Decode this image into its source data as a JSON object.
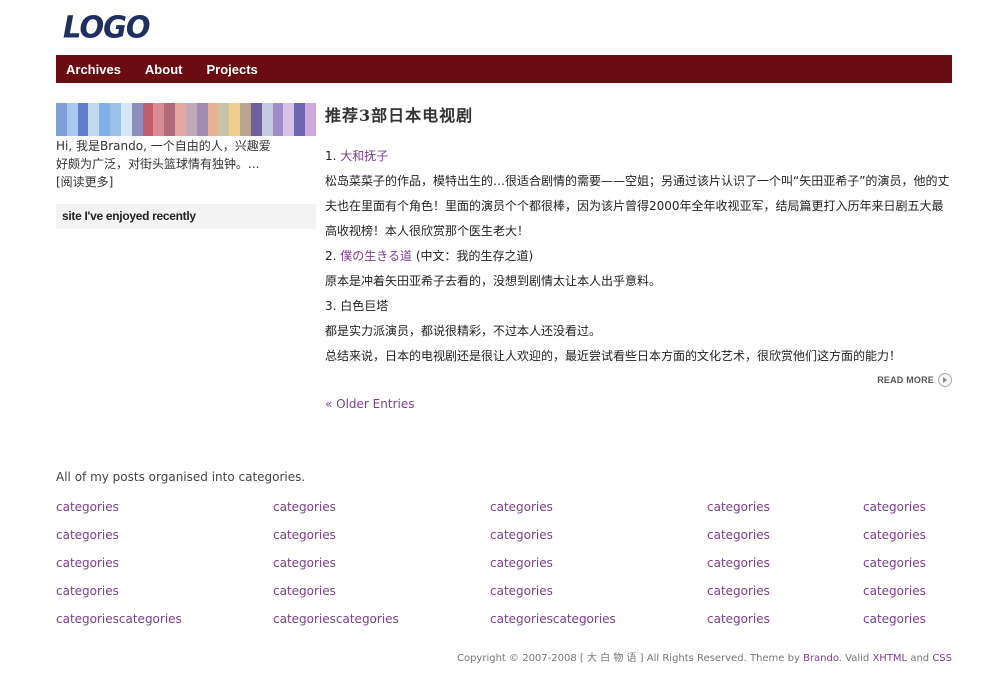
{
  "logo": "LOGO",
  "nav": {
    "items": [
      {
        "label": "Archives"
      },
      {
        "label": "About"
      },
      {
        "label": "Projects"
      }
    ]
  },
  "sidebar": {
    "banner_colors": [
      "#7f9fd6",
      "#a8c8ef",
      "#5f7fc8",
      "#c0d9f0",
      "#7fb0e8",
      "#9ac1ea",
      "#d7e6f7",
      "#8e8fb8",
      "#c25c6f",
      "#d98c96",
      "#b26a7a",
      "#e6a7a1",
      "#c3a9b7",
      "#9e8bb6",
      "#e8b08c",
      "#c9c4a8",
      "#f0cf8c",
      "#b7a78e",
      "#6f5fa0",
      "#c4c8e2",
      "#a08cc8",
      "#d6c3e6",
      "#7066b0",
      "#cba9d8"
    ],
    "intro": "Hi, 我是Brando, 一个自由的人，兴趣爱好颇为广泛，对街头篮球情有独钟。...[阅读更多]",
    "box_title": "site I've enjoyed recently"
  },
  "post": {
    "title": "推荐3部日本电视剧",
    "item1_num": "1. ",
    "item1_link": "大和抚子",
    "para1": "松岛菜菜子的作品，模特出生的…很适合剧情的需要——空姐；另通过该片认识了一个叫“矢田亚希子”的演员，他的丈夫也在里面有个角色！里面的演员个个都很棒，因为该片曾得2000年全年收视亚军，结局篇更打入历年来日剧五大最高收视榜！本人很欣赏那个医生老大！",
    "item2_num": "2. ",
    "item2_link": "僕の生きる道",
    "item2_suffix": " (中文：我的生存之道)",
    "para2": "原本是冲着矢田亚希子去看的，没想到剧情太让本人出乎意料。",
    "item3": "3. 白色巨塔",
    "para3": "都是实力派演员，都说很精彩，不过本人还没看过。",
    "para4": "总结来说，日本的电视剧还是很让人欢迎的，最近尝试看些日本方面的文化艺术，很欣赏他们这方面的能力！",
    "read_more": "READ MORE",
    "older_entries": "« Older Entries"
  },
  "categories": {
    "intro": "All of my posts organised into categories.",
    "rows": [
      [
        "categories",
        "categories",
        "categories",
        "categories",
        "categories"
      ],
      [
        "categories",
        "categories",
        "categories",
        "categories",
        "categories"
      ],
      [
        "categories",
        "categories",
        "categories",
        "categories",
        "categories"
      ],
      [
        "categories",
        "categories",
        "categories",
        "categories",
        "categories"
      ],
      [
        "categoriescategories",
        "categoriescategories",
        "categoriescategories",
        "categories",
        "categories"
      ]
    ]
  },
  "footer": {
    "copyright": "Copyright © 2007-2008 [ 大 白 物 语 ] All Rights Reserved. Theme by ",
    "theme_author": "Brando",
    "valid": ". Valid ",
    "xhtml": "XHTML",
    "and": " and ",
    "css": "CSS"
  }
}
